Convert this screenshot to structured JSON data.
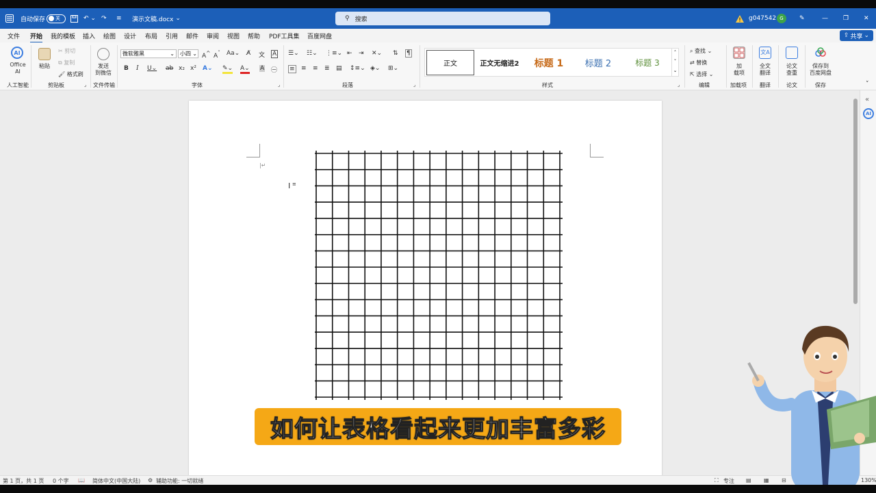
{
  "titlebar": {
    "autosave_label": "自动保存",
    "autosave_state": "关",
    "doc_title": "演示文稿.docx",
    "search_placeholder": "搜索",
    "user_name": "g047542",
    "user_initial": "G"
  },
  "menu": {
    "tabs": [
      "文件",
      "开始",
      "我的模板",
      "插入",
      "绘图",
      "设计",
      "布局",
      "引用",
      "邮件",
      "审阅",
      "视图",
      "帮助",
      "PDF工具集",
      "百度网盘"
    ],
    "active_tab": "开始",
    "share_label": "共享"
  },
  "ribbon": {
    "office_ai": "Office AI",
    "ai_group": "人工智能",
    "paste": "粘贴",
    "cut": "剪切",
    "copy": "复制",
    "format_painter": "格式刷",
    "clipboard_group": "剪贴板",
    "send_wechat_1": "发送",
    "send_wechat_2": "到微信",
    "file_transfer_group": "文件传输",
    "font_name": "微软雅黑",
    "font_size": "小四",
    "font_group": "字体",
    "paragraph_group": "段落",
    "styles": [
      "正文",
      "正文无缩进2",
      "标题 1",
      "标题 2",
      "标题 3"
    ],
    "styles_group": "样式",
    "find": "查找",
    "replace": "替换",
    "select": "选择",
    "edit_group": "编辑",
    "addins_1": "加",
    "addins_2": "载项",
    "addins_group": "加载项",
    "translate_1": "全文",
    "translate_2": "翻译",
    "translate_group": "翻译",
    "paper_1": "论文",
    "paper_2": "查重",
    "paper_group": "论文",
    "save_baidu_1": "保存到",
    "save_baidu_2": "百度网盘",
    "save_group": "保存"
  },
  "colors": {
    "titlebar_bg": "#1c5fb8",
    "subtitle_bg": "#f5a816",
    "style_heading1": "#c76b1a",
    "style_heading2": "#3a6fb0",
    "style_heading3": "#5d8f3a"
  },
  "document": {
    "grid_rows": 15,
    "grid_cols": 15
  },
  "status": {
    "page": "第 1 页，共 1 页",
    "words": "0 个字",
    "language": "简体中文(中国大陆)",
    "accessibility": "辅助功能: 一切就绪",
    "focus": "专注",
    "zoom": "130%"
  },
  "subtitle_text": "如何让表格看起来更加丰富多彩"
}
